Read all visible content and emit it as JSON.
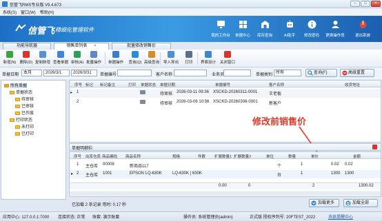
{
  "window": {
    "title": "信管飞RMS专业版 V9.4.673",
    "min": "–",
    "max": "□",
    "close": "×"
  },
  "menu": [
    "系统(S)",
    "窗口(W)",
    "帮助(H)"
  ],
  "brand": {
    "name": "信管飞",
    "sub": "精细化管理软件"
  },
  "topnav": [
    {
      "label": "我的工作台",
      "icon": "monitor-icon"
    },
    {
      "label": "单据中心",
      "icon": "document-grid-icon"
    },
    {
      "label": "库存查询",
      "icon": "warehouse-icon"
    },
    {
      "label": "AI助手",
      "icon": "ai-icon"
    },
    {
      "label": "修改密码",
      "icon": "info-icon"
    },
    {
      "label": "更换操作员",
      "icon": "user-switch-icon"
    },
    {
      "label": "退出系统",
      "icon": "power-icon"
    }
  ],
  "tabs": [
    {
      "label": "功能导航器"
    },
    {
      "label": "销售单列表"
    },
    {
      "label": "批量修改销售价"
    }
  ],
  "tab_close": "×",
  "toolbar": [
    {
      "label": "新增(N)",
      "icon": "add-icon",
      "color": "#3aa63a"
    },
    {
      "label": "删除(D)",
      "icon": "delete-icon",
      "color": "#d9352a"
    },
    {
      "label": "复制新增",
      "icon": "copy-icon",
      "color": "#5a8fd0"
    },
    {
      "label": "查看单据",
      "icon": "view-icon",
      "color": "#3f87d6"
    },
    {
      "label": "审核(A)",
      "icon": "audit-icon",
      "color": "#2f9e5a"
    },
    {
      "label": "批量操作",
      "icon": "batch-icon",
      "color": "#5e88c8"
    },
    {
      "label": "单据操作",
      "icon": "doc-action-icon",
      "color": "#3a7dc9"
    },
    {
      "label": "查询(Q)",
      "icon": "query-icon",
      "color": "#2e8bd8"
    },
    {
      "label": "高级查询",
      "icon": "advanced-query-icon",
      "color": "#d98a2a"
    },
    {
      "label": "导入导出",
      "icon": "import-export-icon",
      "color": "#4d8fd4"
    },
    {
      "label": "打印",
      "icon": "print-icon",
      "color": "#5b6f8a"
    },
    {
      "label": "界面设计",
      "icon": "layout-icon",
      "color": "#3f87d6"
    },
    {
      "label": "关闭窗口",
      "icon": "close-window-icon",
      "color": "#d9352a"
    }
  ],
  "filter": {
    "date_label": "单据日期",
    "date_range": "本月",
    "date_from": "2026/3/1",
    "date_to": "2026/3/31",
    "doc_no_label": "单据编号",
    "customer_label": "客户名称",
    "salesman_label": "业务员",
    "category_label": "单据类别",
    "category_value": "所有",
    "query_btn": "查询(F)",
    "reset_btn": "高级重置"
  },
  "tree": [
    {
      "label": "所有单据",
      "level": 0
    },
    {
      "label": "单据状态",
      "level": 1
    },
    {
      "label": "待审核",
      "level": 2
    },
    {
      "label": "已审核",
      "level": 2
    },
    {
      "label": "已作废",
      "level": 2
    },
    {
      "label": "打印状态",
      "level": 1
    },
    {
      "label": "未打印",
      "level": 2
    },
    {
      "label": "已打印",
      "level": 2
    }
  ],
  "master": {
    "headers": [
      "序号",
      "标记",
      "标记备注",
      "打印",
      "单据状态",
      "单据日期",
      "单据编号",
      "客户名称",
      "收货地址"
    ],
    "rows": [
      {
        "no": "1",
        "status": "待审核",
        "date": "2026-03-11 09:36",
        "code": "XSCKD-20260311-0001",
        "customer": "王老板"
      },
      {
        "no": "2",
        "status": "待审核",
        "date": "2026-03-06 10:56",
        "code": "XSCKD-20260306-0001",
        "customer": "新客户"
      }
    ]
  },
  "annotation": "修改前销售价",
  "detail": {
    "title": "单据明细栏:",
    "headers": [
      "序号",
      "出库仓库",
      "商品编码",
      "商品名称",
      "规格",
      "件数",
      "扩展数量1",
      "扩展数量2",
      "单位",
      "数量",
      "单价",
      "金额"
    ],
    "rows": [
      {
        "no": "1",
        "warehouse": "主仓库",
        "code": "00008",
        "name": "新商品117",
        "spec": "",
        "unit": "个",
        "qty": "1",
        "price": "0.02",
        "amount": "0.02"
      },
      {
        "no": "2",
        "warehouse": "主仓库",
        "code": "1001",
        "name": "EPSON LQ-630K",
        "spec": "LQ-630K | 630K",
        "unit": "台",
        "qty": "1",
        "price": "1300",
        "amount": "1300"
      }
    ],
    "totals": {
      "pieces": "0.00",
      "ext1": "0",
      "qty": "2",
      "amount": "1300.02"
    }
  },
  "summary": "已加载 2 条记录 用时: 0.17 秒",
  "load_more": "加载更多",
  "load_all": "加载全部",
  "statusbar": {
    "server": "应用中心: 127.0.0.1:7000",
    "connection": "连接状态: 正常",
    "account": "账套: 演示账套",
    "operator": "操作员: 系统管理员(admin)",
    "license": "正式版 授权序列号: 20FTEST_2022",
    "message": "消息提醒中心"
  }
}
